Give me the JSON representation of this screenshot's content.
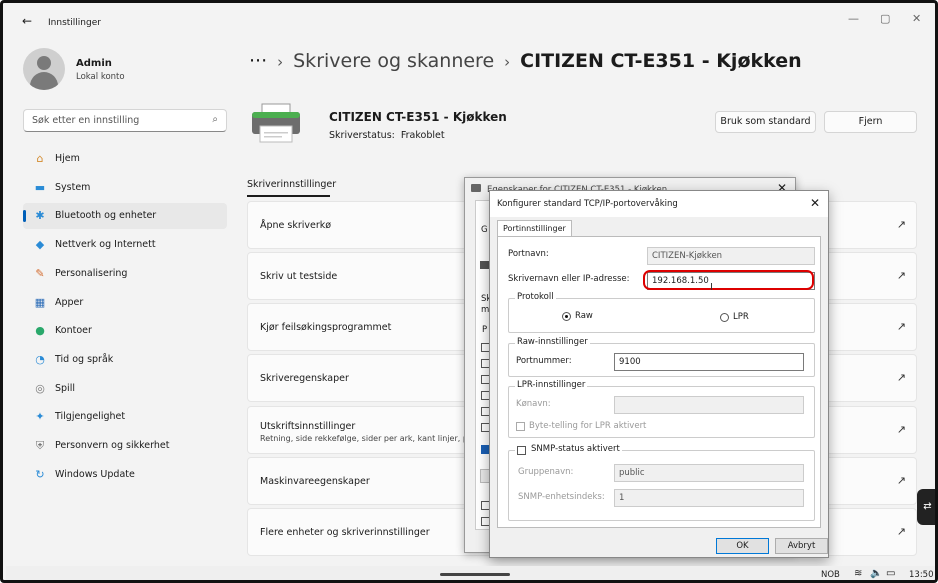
{
  "window": {
    "back_icon": "back-arrow-icon",
    "title": "Innstillinger",
    "minimize": "—",
    "maximize": "▢",
    "close": "✕"
  },
  "profile": {
    "name": "Admin",
    "account": "Lokal konto"
  },
  "search": {
    "placeholder": "Søk etter en innstilling",
    "icon": "⌕"
  },
  "nav": [
    {
      "label": "Hjem",
      "icon": "⌂",
      "color": "#d38b2e"
    },
    {
      "label": "System",
      "icon": "▬",
      "color": "#2a8bd6"
    },
    {
      "label": "Bluetooth og enheter",
      "icon": "✱",
      "color": "#2a8bd6"
    },
    {
      "label": "Nettverk og Internett",
      "icon": "◆",
      "color": "#2a8bd6"
    },
    {
      "label": "Personalisering",
      "icon": "✎",
      "color": "#d36b2e"
    },
    {
      "label": "Apper",
      "icon": "▦",
      "color": "#2a6bb6"
    },
    {
      "label": "Kontoer",
      "icon": "●",
      "color": "#2aa86b"
    },
    {
      "label": "Tid og språk",
      "icon": "◔",
      "color": "#2a8bd6"
    },
    {
      "label": "Spill",
      "icon": "◎",
      "color": "#777"
    },
    {
      "label": "Tilgjengelighet",
      "icon": "✦",
      "color": "#2a8bd6"
    },
    {
      "label": "Personvern og sikkerhet",
      "icon": "⛨",
      "color": "#777"
    },
    {
      "label": "Windows Update",
      "icon": "↻",
      "color": "#2a8bd6"
    }
  ],
  "breadcrumb": {
    "dots": "···",
    "sep": "›",
    "mid": "Skrivere og skannere",
    "current": "CITIZEN CT-E351 - Kjøkken"
  },
  "device": {
    "title": "CITIZEN CT-E351 - Kjøkken",
    "status_label": "Skriverstatus:",
    "status_value": "Frakoblet"
  },
  "buttons": {
    "default": "Bruk som standard",
    "remove": "Fjern"
  },
  "section_tab": "Skriverinnstillinger",
  "cards": [
    {
      "title": "Åpne skriverkø",
      "sub": ""
    },
    {
      "title": "Skriv ut testside",
      "sub": ""
    },
    {
      "title": "Kjør feilsøkingsprogrammet",
      "sub": ""
    },
    {
      "title": "Skriveregenskaper",
      "sub": ""
    },
    {
      "title": "Utskriftsinnstillinger",
      "sub": "Retning, side rekkefølge, sider per ark, kant linjer, pa"
    },
    {
      "title": "Maskinvareegenskaper",
      "sub": ""
    },
    {
      "title": "Flere enheter og skriverinnstillinger",
      "sub": ""
    }
  ],
  "ext_icon": "↗",
  "dialog_back": {
    "title": "Egenskaper for CITIZEN CT-E351 - Kjøkken",
    "close": "✕",
    "frag1": "G",
    "frag2": "Sk",
    "frag3": "m",
    "frag4": "P"
  },
  "dialog": {
    "title": "Konfigurer standard TCP/IP-portovervåking",
    "close": "✕",
    "tab": "Portinnstillinger",
    "port_name_label": "Portnavn:",
    "port_name_value": "CITIZEN-Kjøkken",
    "ip_label": "Skrivernavn eller IP-adresse:",
    "ip_value": "192.168.1.50",
    "protocol_group": "Protokoll",
    "raw": "Raw",
    "lpr": "LPR",
    "raw_group": "Raw-innstillinger",
    "port_number_label": "Portnummer:",
    "port_number_value": "9100",
    "lpr_group": "LPR-innstillinger",
    "queue_label": "Kønavn:",
    "byte_count": "Byte-telling for LPR aktivert",
    "snmp_label": "SNMP-status aktivert",
    "community_label": "Gruppenavn:",
    "community_value": "public",
    "snmp_index_label": "SNMP-enhetsindeks:",
    "snmp_index_value": "1",
    "ok": "OK",
    "cancel": "Avbryt"
  },
  "taskbar": {
    "lang": "NOB",
    "wifi": "≋",
    "volume": "🔈",
    "battery": "▭",
    "time": "13:50",
    "side_chip": "⇄"
  }
}
